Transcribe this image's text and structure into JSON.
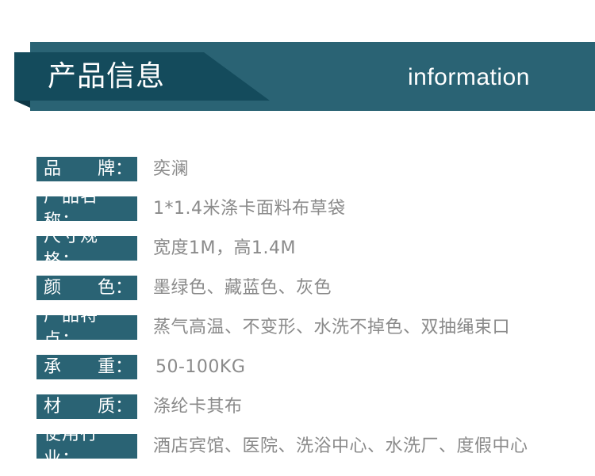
{
  "header": {
    "title_zh": "产品信息",
    "title_en": "information",
    "colors": {
      "band": "#2a6374",
      "ribbon": "#144b5c",
      "fold": "#0d3644"
    }
  },
  "specs": [
    {
      "label_chars": [
        "品",
        "牌："
      ],
      "value": "奕澜"
    },
    {
      "label_chars": [
        "产品名称："
      ],
      "value": "1*1.4米涤卡面料布草袋"
    },
    {
      "label_chars": [
        "尺寸规格："
      ],
      "value": "宽度1M，高1.4M"
    },
    {
      "label_chars": [
        "颜",
        "色："
      ],
      "value": "墨绿色、藏蓝色、灰色"
    },
    {
      "label_chars": [
        "产品特点："
      ],
      "value": "蒸气高温、不变形、水洗不掉色、双抽绳束口"
    },
    {
      "label_chars": [
        "承",
        "重："
      ],
      "value": "50-100KG"
    },
    {
      "label_chars": [
        "材",
        "质："
      ],
      "value": "涤纶卡其布"
    },
    {
      "label_chars": [
        "使用行业："
      ],
      "value": "酒店宾馆、医院、洗浴中心、水洗厂、度假中心"
    }
  ],
  "colors": {
    "label_bg": "#2a6374",
    "label_text": "#ffffff",
    "value_text": "#8a8a8a"
  }
}
